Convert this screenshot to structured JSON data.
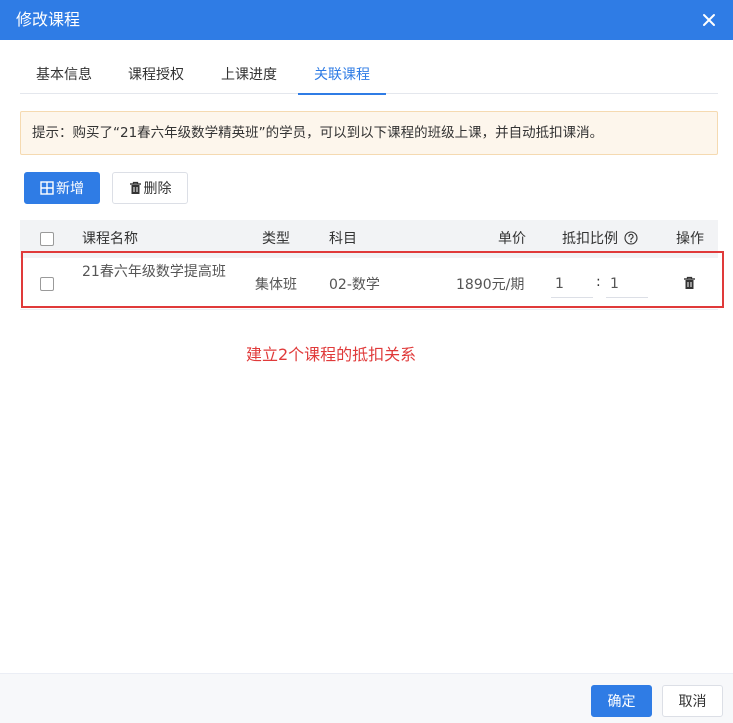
{
  "dialog": {
    "title": "修改课程"
  },
  "tabs": [
    {
      "label": "基本信息",
      "active": false
    },
    {
      "label": "课程授权",
      "active": false
    },
    {
      "label": "上课进度",
      "active": false
    },
    {
      "label": "关联课程",
      "active": true
    }
  ],
  "hint": {
    "text": "提示：购买了“21春六年级数学精英班”的学员，可以到以下课程的班级上课，并自动抵扣课消。"
  },
  "toolbar": {
    "add_label": "新增",
    "delete_label": "删除"
  },
  "table": {
    "headers": {
      "name": "课程名称",
      "type": "类型",
      "subject": "科目",
      "price": "单价",
      "ratio": "抵扣比例",
      "action": "操作"
    },
    "rows": [
      {
        "name": "21春六年级数学提高班",
        "type": "集体班",
        "subject": "02-数学",
        "price": "1890元/期",
        "ratio_left": "1",
        "ratio_sep": ":",
        "ratio_right": "1"
      }
    ]
  },
  "annotation": {
    "text": "建立2个课程的抵扣关系"
  },
  "footer": {
    "confirm_label": "确定",
    "cancel_label": "取消"
  },
  "colors": {
    "primary": "#2f7ce5",
    "annotation_red": "#e03a3a",
    "hint_bg": "#fdf6ec"
  },
  "icons": {
    "close": "close-icon",
    "add": "grid-plus-icon",
    "delete": "trash-icon",
    "help": "question-circle-icon",
    "row_delete": "trash-icon"
  }
}
